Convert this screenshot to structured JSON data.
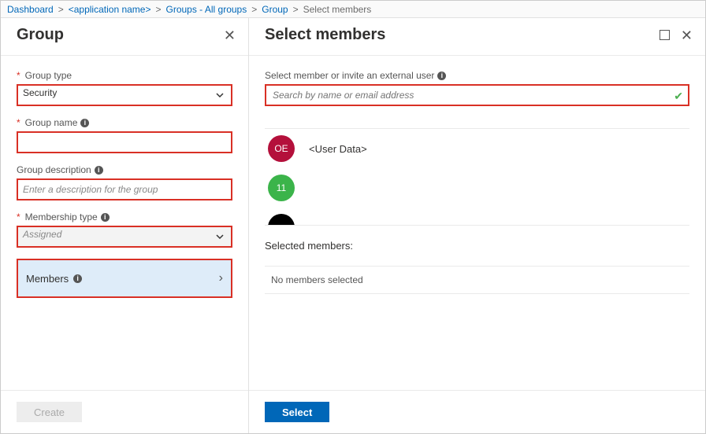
{
  "breadcrumb": {
    "dashboard": "Dashboard",
    "app": "<application name>",
    "groups": "Groups - All groups",
    "group": "Group",
    "current": "Select members"
  },
  "leftBlade": {
    "title": "Group",
    "fields": {
      "groupTypeLabel": "Group type",
      "groupTypeValue": "Security",
      "groupNameLabel": "Group name",
      "groupNameValue": "",
      "groupDescLabel": "Group description",
      "groupDescPlaceholder": "Enter a description for the group",
      "membershipTypeLabel": "Membership type",
      "membershipTypeValue": "Assigned",
      "membersLabel": "Members"
    },
    "createButton": "Create"
  },
  "rightBlade": {
    "title": "Select members",
    "searchLabel": "Select member or invite an external user",
    "searchPlaceholder": "Search by name or email address",
    "items": [
      {
        "initials": "OE",
        "color": "#b4103b",
        "name": "<User Data>"
      },
      {
        "initials": "11",
        "color": "#3bb44a",
        "name": ""
      }
    ],
    "selectedLabel": "Selected members:",
    "noSelection": "No members selected",
    "selectButton": "Select"
  }
}
